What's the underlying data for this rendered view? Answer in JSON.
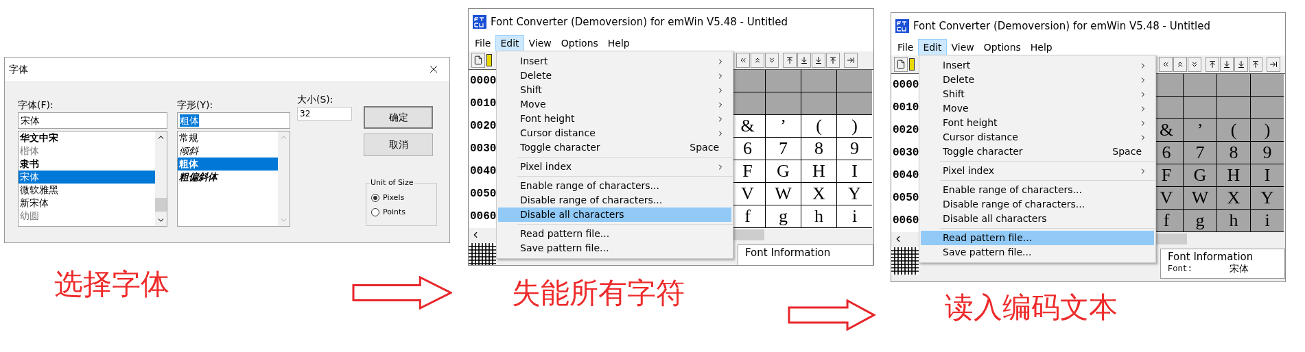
{
  "step_1": {
    "dialog": {
      "title": "字体",
      "font": {
        "label": "字体(F):",
        "value": "宋体",
        "items": [
          {
            "label": "华文中宋",
            "kind": "bold",
            "selected": false
          },
          {
            "label": "楷体",
            "kind": "light",
            "selected": false
          },
          {
            "label": "隶书",
            "kind": "bold",
            "selected": false
          },
          {
            "label": "宋体",
            "kind": "regular",
            "selected": true
          },
          {
            "label": "微软雅黑",
            "kind": "regular",
            "selected": false
          },
          {
            "label": "新宋体",
            "kind": "regular",
            "selected": false
          },
          {
            "label": "幼圆",
            "kind": "light",
            "selected": false
          }
        ]
      },
      "style": {
        "label": "字形(Y):",
        "value": "粗体",
        "value_highlighted": true,
        "items": [
          {
            "label": "常规",
            "kind": "regular",
            "selected": false
          },
          {
            "label": "倾斜",
            "kind": "italic",
            "selected": false
          },
          {
            "label": "粗体",
            "kind": "bold",
            "selected": true
          },
          {
            "label": "粗偏斜体",
            "kind": "bold-italic",
            "selected": false
          }
        ]
      },
      "size": {
        "label": "大小(S):",
        "value": "32"
      },
      "buttons": [
        "确定",
        "取消"
      ],
      "unit_of_size": {
        "title": "Unit of Size",
        "options": [
          {
            "label": "Pixels",
            "selected": true
          },
          {
            "label": "Points",
            "selected": false
          }
        ]
      }
    },
    "caption": "选择字体"
  },
  "step_2": {
    "window": {
      "title": "Font Converter (Demoversion) for emWin V5.48 - Untitled",
      "menus": [
        {
          "label": "File",
          "selected": false
        },
        {
          "label": "Edit",
          "selected": true
        },
        {
          "label": "View",
          "selected": false
        },
        {
          "label": "Options",
          "selected": false
        },
        {
          "label": "Help",
          "selected": false
        }
      ],
      "menu_groups": [
        [
          {
            "label": "Insert",
            "submenu": true,
            "selected": false
          },
          {
            "label": "Delete",
            "submenu": true,
            "selected": false
          },
          {
            "label": "Shift",
            "submenu": true,
            "selected": false
          },
          {
            "label": "Move",
            "submenu": true,
            "selected": false
          },
          {
            "label": "Font height",
            "submenu": true,
            "selected": false
          },
          {
            "label": "Cursor distance",
            "submenu": true,
            "selected": false
          },
          {
            "label": "Toggle character",
            "shortcut": "Space",
            "submenu": false,
            "selected": false
          }
        ],
        [
          {
            "label": "Pixel index",
            "submenu": true,
            "selected": false
          }
        ],
        [
          {
            "label": "Enable range of characters...",
            "submenu": false,
            "selected": false
          },
          {
            "label": "Disable range of characters...",
            "submenu": false,
            "selected": false
          },
          {
            "label": "Disable all characters",
            "submenu": false,
            "selected": true
          }
        ],
        [
          {
            "label": "Read pattern file...",
            "submenu": false,
            "selected": false
          },
          {
            "label": "Save pattern file...",
            "submenu": false,
            "selected": false
          }
        ]
      ],
      "rows": [
        {
          "label": "0000",
          "cells": [
            {
              "enabled": false
            },
            {
              "enabled": false
            },
            {
              "enabled": false
            },
            {
              "enabled": false
            }
          ]
        },
        {
          "label": "0010",
          "cells": [
            {
              "enabled": false
            },
            {
              "enabled": false
            },
            {
              "enabled": false
            },
            {
              "enabled": false
            }
          ]
        },
        {
          "label": "0020",
          "cells": [
            {
              "char": "&",
              "enabled": true
            },
            {
              "char": "’",
              "enabled": true
            },
            {
              "char": "(",
              "enabled": true
            },
            {
              "char": ")",
              "enabled": true
            }
          ]
        },
        {
          "label": "0030",
          "cells": [
            {
              "char": "6",
              "enabled": true
            },
            {
              "char": "7",
              "enabled": true
            },
            {
              "char": "8",
              "enabled": true
            },
            {
              "char": "9",
              "enabled": true
            }
          ]
        },
        {
          "label": "0040",
          "cells": [
            {
              "char": "F",
              "enabled": true
            },
            {
              "char": "G",
              "enabled": true
            },
            {
              "char": "H",
              "enabled": true
            },
            {
              "char": "I",
              "enabled": true
            }
          ]
        },
        {
          "label": "0050",
          "cells": [
            {
              "char": "V",
              "enabled": true
            },
            {
              "char": "W",
              "enabled": true
            },
            {
              "char": "X",
              "enabled": true
            },
            {
              "char": "Y",
              "enabled": true
            }
          ]
        },
        {
          "label": "0060",
          "cells": [
            {
              "char": "f",
              "enabled": true
            },
            {
              "char": "g",
              "enabled": true
            },
            {
              "char": "h",
              "enabled": true
            },
            {
              "char": "i",
              "enabled": true
            }
          ]
        }
      ],
      "font_info": {
        "title": "Font Information"
      }
    },
    "caption": "失能所有字符"
  },
  "step_3": {
    "window": {
      "title": "Font Converter (Demoversion) for emWin V5.48 - Untitled",
      "menus": [
        {
          "label": "File",
          "selected": false
        },
        {
          "label": "Edit",
          "selected": true
        },
        {
          "label": "View",
          "selected": false
        },
        {
          "label": "Options",
          "selected": false
        },
        {
          "label": "Help",
          "selected": false
        }
      ],
      "menu_groups": [
        [
          {
            "label": "Insert",
            "submenu": true,
            "selected": false
          },
          {
            "label": "Delete",
            "submenu": true,
            "selected": false
          },
          {
            "label": "Shift",
            "submenu": true,
            "selected": false
          },
          {
            "label": "Move",
            "submenu": true,
            "selected": false
          },
          {
            "label": "Font height",
            "submenu": true,
            "selected": false
          },
          {
            "label": "Cursor distance",
            "submenu": true,
            "selected": false
          },
          {
            "label": "Toggle character",
            "shortcut": "Space",
            "submenu": false,
            "selected": false
          }
        ],
        [
          {
            "label": "Pixel index",
            "submenu": true,
            "selected": false
          }
        ],
        [
          {
            "label": "Enable range of characters...",
            "submenu": false,
            "selected": false
          },
          {
            "label": "Disable range of characters...",
            "submenu": false,
            "selected": false
          },
          {
            "label": "Disable all characters",
            "submenu": false,
            "selected": false
          }
        ],
        [
          {
            "label": "Read pattern file...",
            "submenu": false,
            "selected": true
          },
          {
            "label": "Save pattern file...",
            "submenu": false,
            "selected": false
          }
        ]
      ],
      "rows": [
        {
          "label": "0000",
          "cells": [
            {
              "enabled": false
            },
            {
              "enabled": false
            },
            {
              "enabled": false
            },
            {
              "enabled": false
            }
          ]
        },
        {
          "label": "0010",
          "cells": [
            {
              "enabled": false
            },
            {
              "enabled": false
            },
            {
              "enabled": false
            },
            {
              "enabled": false
            }
          ]
        },
        {
          "label": "0020",
          "cells": [
            {
              "char": "&",
              "enabled": false
            },
            {
              "char": "’",
              "enabled": false
            },
            {
              "char": "(",
              "enabled": false
            },
            {
              "char": ")",
              "enabled": false
            }
          ]
        },
        {
          "label": "0030",
          "cells": [
            {
              "char": "6",
              "enabled": false
            },
            {
              "char": "7",
              "enabled": false
            },
            {
              "char": "8",
              "enabled": false
            },
            {
              "char": "9",
              "enabled": false
            }
          ]
        },
        {
          "label": "0040",
          "cells": [
            {
              "char": "F",
              "enabled": false
            },
            {
              "char": "G",
              "enabled": false
            },
            {
              "char": "H",
              "enabled": false
            },
            {
              "char": "I",
              "enabled": false
            }
          ]
        },
        {
          "label": "0050",
          "cells": [
            {
              "char": "V",
              "enabled": false
            },
            {
              "char": "W",
              "enabled": false
            },
            {
              "char": "X",
              "enabled": false
            },
            {
              "char": "Y",
              "enabled": false
            }
          ]
        },
        {
          "label": "0060",
          "cells": [
            {
              "char": "f",
              "enabled": false
            },
            {
              "char": "g",
              "enabled": false
            },
            {
              "char": "h",
              "enabled": false
            },
            {
              "char": "i",
              "enabled": false
            }
          ]
        }
      ],
      "font_info": {
        "title": "Font Information",
        "font_label": "Font:",
        "font_value": "宋体"
      }
    },
    "caption": "读入编码文本"
  }
}
